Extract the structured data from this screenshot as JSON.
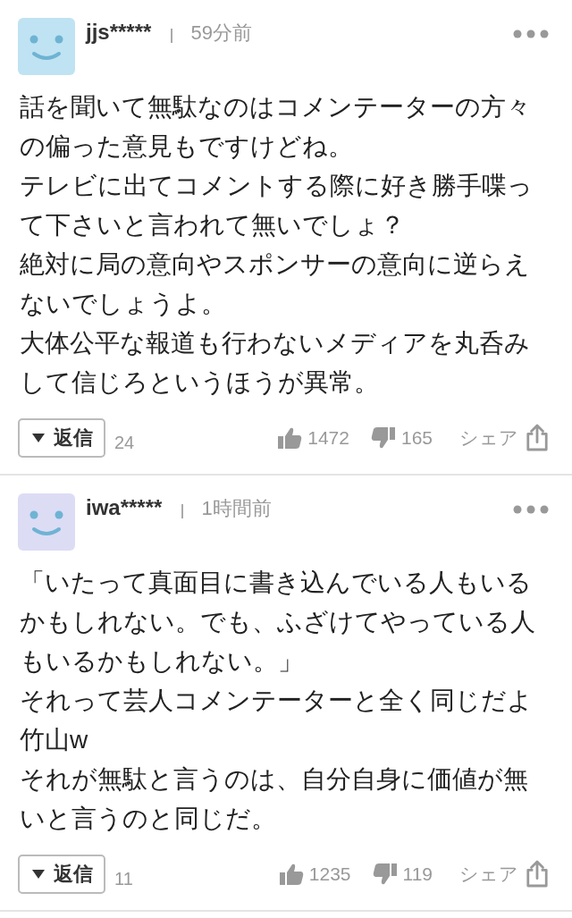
{
  "comments": [
    {
      "color": "#bfe3f2",
      "user": "jjs*****",
      "time": "59分前",
      "lines": [
        "話を聞いて無駄なのはコメンテーターの方々",
        "の偏った意見もですけどね。",
        "テレビに出てコメントする際に好き勝手喋っ",
        "て下さいと言われて無いでしょ？",
        "絶対に局の意向やスポンサーの意向に逆らえ",
        "ないでしょうよ。",
        "大体公平な報道も行わないメディアを丸呑み",
        "して信じろというほうが異常。"
      ],
      "reply_label": "返信",
      "reply_count": "24",
      "likes": "1472",
      "dislikes": "165",
      "share_label": "シェア"
    },
    {
      "color": "#dcdcf5",
      "user": "iwa*****",
      "time": "1時間前",
      "lines": [
        "「いたって真面目に書き込んでいる人もいる",
        "かもしれない。でも、ふざけてやっている人",
        "もいるかもしれない。」",
        "それって芸人コメンテーターと全く同じだよ",
        "竹山w",
        "それが無駄と言うのは、自分自身に価値が無",
        "いと言うのと同じだ。"
      ],
      "reply_label": "返信",
      "reply_count": "11",
      "likes": "1235",
      "dislikes": "119",
      "share_label": "シェア"
    }
  ]
}
